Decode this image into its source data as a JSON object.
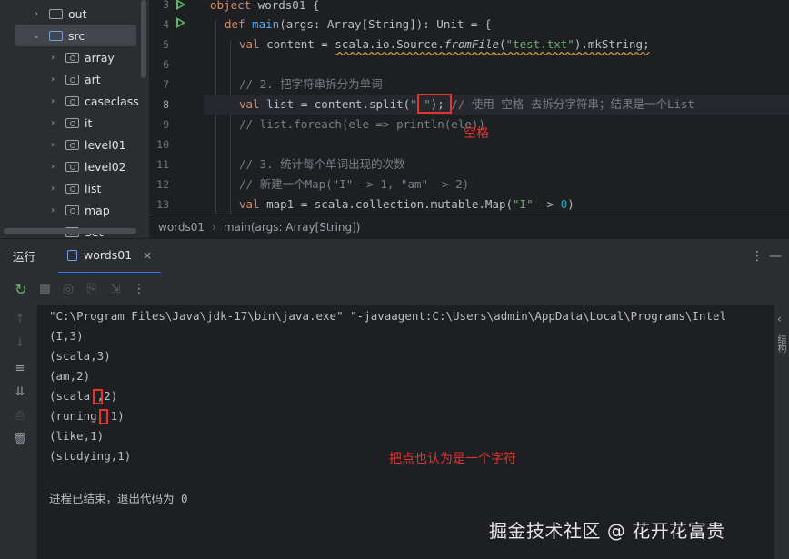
{
  "tree": {
    "items": [
      {
        "label": "out",
        "chevron": "›",
        "kind": "folder"
      },
      {
        "label": "src",
        "chevron": "⌄",
        "kind": "src"
      },
      {
        "label": "array",
        "chevron": "›",
        "kind": "pkg"
      },
      {
        "label": "art",
        "chevron": "›",
        "kind": "pkg"
      },
      {
        "label": "caseclass",
        "chevron": "›",
        "kind": "pkg"
      },
      {
        "label": "it",
        "chevron": "›",
        "kind": "pkg"
      },
      {
        "label": "level01",
        "chevron": "›",
        "kind": "pkg"
      },
      {
        "label": "level02",
        "chevron": "›",
        "kind": "pkg"
      },
      {
        "label": "list",
        "chevron": "›",
        "kind": "pkg"
      },
      {
        "label": "map",
        "chevron": "›",
        "kind": "pkg"
      },
      {
        "label": "Set",
        "chevron": "›",
        "kind": "pkg"
      }
    ]
  },
  "editor": {
    "line_numbers": [
      "3",
      "4",
      "5",
      "6",
      "7",
      "8",
      "9",
      "10",
      "11",
      "12",
      "13"
    ],
    "current_line": "8",
    "lines": {
      "l3": {
        "kw": "object",
        "name": " words01 {"
      },
      "l4": {
        "kw": "def",
        "fn": "main",
        "rest": "(args: Array[String]): Unit = {"
      },
      "l5": {
        "kw": "val",
        "a": " content = ",
        "b": "scala.io.Source.",
        "c": "fromFile",
        "d": "(",
        "str": "\"test.txt\"",
        "e": ").mkString;"
      },
      "l7": {
        "com": "// 2. 把字符串拆分为单词"
      },
      "l8": {
        "kw": "val",
        "a": " list = content.split(",
        "str": "\" \"",
        "b": ");",
        "com": " // 使用 空格 去拆分字符串；结果是一个List"
      },
      "l9": {
        "com": "// list.foreach(ele => println(ele))"
      },
      "l11": {
        "com": "// 3. 统计每个单词出现的次数"
      },
      "l12": {
        "com": "// 新建一个Map(\"I\" -> 1, \"am\" -> 2)"
      },
      "l13": {
        "kw": "val",
        "a": " map1 = scala.collection.mutable.Map(",
        "str": "\"I\"",
        "b": " -> ",
        "num": "0",
        "c": ")"
      }
    },
    "annotation_space": "空格"
  },
  "breadcrumb": {
    "items": [
      "words01",
      "main(args: Array[String])"
    ],
    "separator": "›"
  },
  "run_panel": {
    "title": "运行",
    "tab_label": "words01",
    "tab_close": "×",
    "header_more": "⋮",
    "header_minimize": "—"
  },
  "console": {
    "lines": [
      "\"C:\\Program Files\\Java\\jdk-17\\bin\\java.exe\" \"-javaagent:C:\\Users\\admin\\AppData\\Local\\Programs\\Intel",
      "(I,3)",
      "(scala,3)",
      "(am,2)",
      "(scala.,2)",
      "(runing,,1)",
      "(like,1)",
      "(studying,1)",
      "",
      "进程已结束，退出代码为 0"
    ],
    "annotation_dot": "把点也认为是一个字符"
  },
  "right_strip": {
    "chevron": "‹",
    "label": "结构"
  },
  "watermark": "掘金技术社区 @ 花开花富贵",
  "colors": {
    "accent": "#3574f0",
    "annotation_red": "#e3342f",
    "run_green": "#5fb865"
  }
}
